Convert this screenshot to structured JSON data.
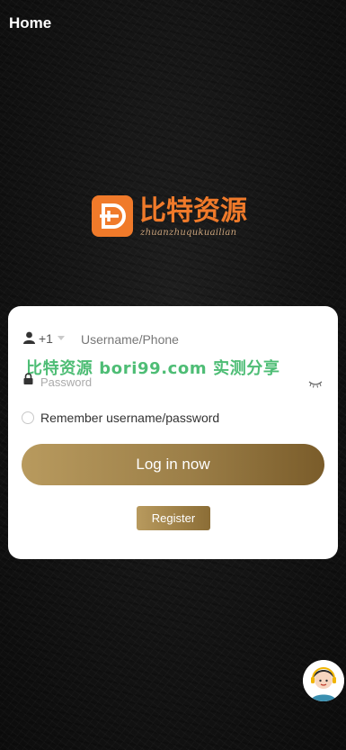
{
  "header": {
    "title": "Home"
  },
  "logo": {
    "cn_text": "比特资源",
    "pinyin": "zhuanzhuqukuailian",
    "color": "#f07a2a"
  },
  "login": {
    "country_code": "+1",
    "username_placeholder": "Username/Phone",
    "password_placeholder": "Password",
    "remember_label": "Remember username/password",
    "login_button": "Log in now",
    "register_button": "Register"
  },
  "watermark": {
    "text": "比特资源 bori99.com 实测分享",
    "color": "#3fb86a"
  },
  "theme": {
    "gold_start": "#b89a5e",
    "gold_end": "#7a5c2a"
  },
  "icons": {
    "user": "user-icon",
    "lock": "lock-icon",
    "eye": "eye-closed-icon",
    "support": "customer-support-icon"
  }
}
